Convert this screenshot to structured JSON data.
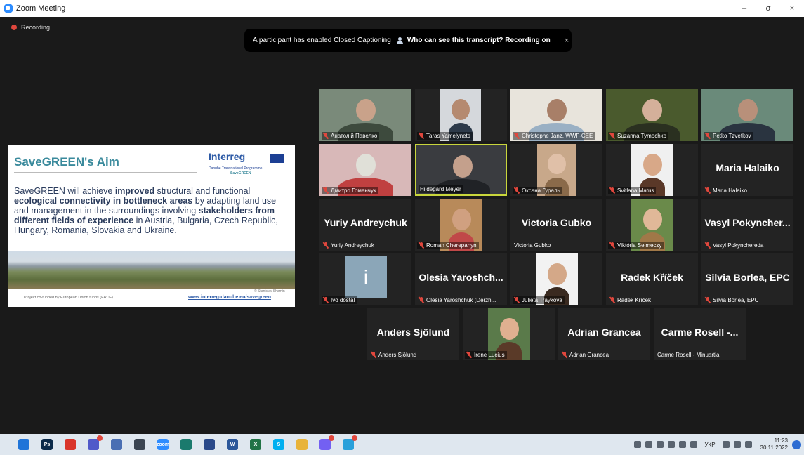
{
  "window": {
    "title": "Zoom Meeting",
    "controls": [
      "–",
      "σ",
      "×"
    ]
  },
  "recording": {
    "label": "Recording"
  },
  "banner": {
    "message": "A participant has enabled Closed Captioning",
    "link": "Who can see this transcript? Recording on",
    "close": "×"
  },
  "share": {
    "heading": "SaveGREEN's Aim",
    "logo_text": "Interreg",
    "programme": "Danube Transnational Programme",
    "project": "SaveGREEN",
    "body_parts": [
      "SaveGREEN will achieve ",
      "improved",
      " structural and functional ",
      "ecological connectivity in bottleneck areas",
      " by adapting land use and management in the surroundings involving ",
      "stakeholders from different fields of experience",
      " in Austria, Bulgaria, Czech Republic, Hungary, Romania, Slovakia and Ukraine."
    ],
    "footer_left": "Project co-funded by European Union funds (ERDF)",
    "footer_right": "www.interreg-danube.eu/savegreen",
    "photo_credit": "© Stanislav Shamin"
  },
  "participants": [
    {
      "id": "p1",
      "name": "Анатолій Павелко",
      "muted": true,
      "kind": "video"
    },
    {
      "id": "p2",
      "name": "Taras Yamelynets",
      "muted": true,
      "kind": "video"
    },
    {
      "id": "p3",
      "name": "Christophe Janz, WWF-CEE",
      "muted": true,
      "kind": "video"
    },
    {
      "id": "p4",
      "name": "Suzanna Tymochko",
      "muted": true,
      "kind": "video"
    },
    {
      "id": "p5",
      "name": "Petko Tzvetkov",
      "muted": true,
      "kind": "video"
    },
    {
      "id": "p6",
      "name": "Дмитро Гоменчук",
      "muted": true,
      "kind": "video"
    },
    {
      "id": "p7",
      "name": "Hildegard Meyer",
      "muted": false,
      "kind": "video",
      "active": true
    },
    {
      "id": "p8",
      "name": "Оксана Гураль",
      "muted": true,
      "kind": "video"
    },
    {
      "id": "p9",
      "name": "Svitlana Matus",
      "muted": true,
      "kind": "video"
    },
    {
      "id": "p10",
      "name": "Maria Halaiko",
      "display": "Maria Halaiko",
      "muted": true,
      "kind": "name"
    },
    {
      "id": "p11",
      "name": "Yuriy Andreychuk",
      "display": "Yuriy Andreychuk",
      "muted": true,
      "kind": "name"
    },
    {
      "id": "p12",
      "name": "Roman Cherepanyn",
      "muted": true,
      "kind": "video"
    },
    {
      "id": "p13",
      "name": "Victoria Gubko",
      "display": "Victoria Gubko",
      "muted": false,
      "kind": "name"
    },
    {
      "id": "p14",
      "name": "Viktória Selmeczy",
      "muted": true,
      "kind": "video"
    },
    {
      "id": "p15",
      "name": "Vasyl Pokynchereda",
      "display": "Vasyl  Pokyncher...",
      "muted": true,
      "kind": "name"
    },
    {
      "id": "p16",
      "name": "Ivo dostál",
      "muted": true,
      "kind": "placeholder",
      "initial": "i"
    },
    {
      "id": "p17",
      "name": "Olesia Yaroshchuk (Derzh...",
      "display": "Olesia  Yaroshch...",
      "muted": true,
      "kind": "name"
    },
    {
      "id": "p18",
      "name": "Julieta Traykova",
      "muted": true,
      "kind": "video"
    },
    {
      "id": "p19",
      "name": "Radek Kříček",
      "display": "Radek  Kříček",
      "muted": true,
      "kind": "name"
    },
    {
      "id": "p20",
      "name": "Silvia Borlea, EPC",
      "display": "Silvia Borlea, EPC",
      "muted": true,
      "kind": "name"
    },
    {
      "id": "p21",
      "name": "Anders Sjölund",
      "display": "Anders Sjölund",
      "muted": true,
      "kind": "name"
    },
    {
      "id": "p22",
      "name": "Irene Lucius",
      "muted": true,
      "kind": "video"
    },
    {
      "id": "p23",
      "name": "Adrian Grancea",
      "display": "Adrian Grancea",
      "muted": true,
      "kind": "name"
    },
    {
      "id": "p24",
      "name": "Carme Rosell - Minuartia",
      "display": "Carme Rosell -...",
      "muted": false,
      "kind": "name"
    }
  ],
  "taskbar": {
    "apps": [
      {
        "name": "windows-start-icon",
        "color": "#1f74d8",
        "text": ""
      },
      {
        "name": "photoshop-icon",
        "color": "#0b2a4a",
        "text": "Ps"
      },
      {
        "name": "app-red-icon",
        "color": "#d9352b",
        "text": ""
      },
      {
        "name": "teams-icon",
        "color": "#5059c9",
        "text": ""
      },
      {
        "name": "app-people-icon",
        "color": "#4a6fb3",
        "text": ""
      },
      {
        "name": "calculator-icon",
        "color": "#3b4552",
        "text": ""
      },
      {
        "name": "zoom-icon",
        "color": "#2d8cff",
        "text": "zoom"
      },
      {
        "name": "search-app-icon",
        "color": "#1a7a6d",
        "text": ""
      },
      {
        "name": "save-app-icon",
        "color": "#2a4a8a",
        "text": ""
      },
      {
        "name": "word-icon",
        "color": "#2b579a",
        "text": "W"
      },
      {
        "name": "excel-icon",
        "color": "#217346",
        "text": "X"
      },
      {
        "name": "skype-icon",
        "color": "#00aff0",
        "text": "S"
      },
      {
        "name": "chrome-icon",
        "color": "#e8b339",
        "text": ""
      },
      {
        "name": "viber-icon",
        "color": "#7360f2",
        "text": ""
      },
      {
        "name": "telegram-icon",
        "color": "#2aa0da",
        "text": ""
      }
    ],
    "language": "УКР",
    "time": "11:23",
    "date": "30.11.2022"
  }
}
